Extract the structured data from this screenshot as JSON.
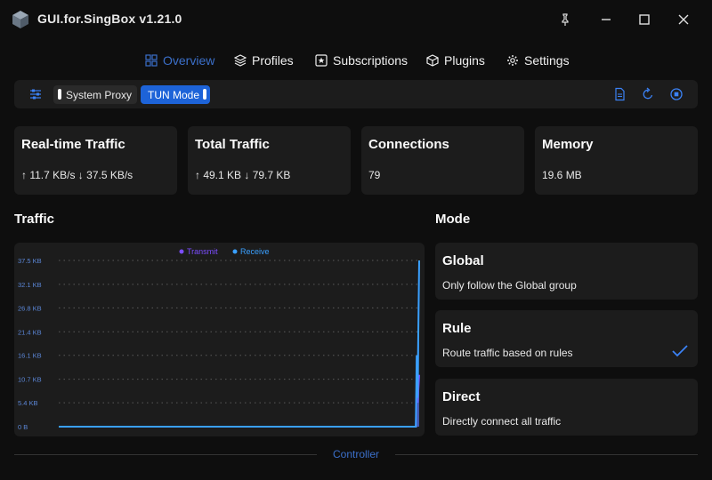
{
  "app": {
    "title": "GUI.for.SingBox v1.21.0"
  },
  "nav": {
    "overview": "Overview",
    "profiles": "Profiles",
    "subscriptions": "Subscriptions",
    "plugins": "Plugins",
    "settings": "Settings",
    "active": "overview"
  },
  "toolbar": {
    "system_proxy": "System Proxy",
    "tun_mode": "TUN Mode",
    "system_proxy_enabled": false,
    "tun_mode_enabled": true
  },
  "stats": {
    "realtime": {
      "title": "Real-time Traffic",
      "value": "↑ 11.7 KB/s ↓ 37.5 KB/s"
    },
    "total": {
      "title": "Total Traffic",
      "value": "↑ 49.1 KB ↓ 79.7 KB"
    },
    "connections": {
      "title": "Connections",
      "value": "79"
    },
    "memory": {
      "title": "Memory",
      "value": "19.6 MB"
    }
  },
  "traffic": {
    "title": "Traffic",
    "legend": {
      "transmit": "Transmit",
      "receive": "Receive"
    },
    "y_ticks": [
      "37.5 KB",
      "32.1 KB",
      "26.8 KB",
      "21.4 KB",
      "16.1 KB",
      "10.7 KB",
      "5.4 KB",
      "0 B"
    ]
  },
  "chart_data": {
    "type": "area",
    "y_ticks_kb": [
      0,
      5.4,
      10.7,
      16.1,
      21.4,
      26.8,
      32.1,
      37.5
    ],
    "ylim": [
      0,
      37.5
    ],
    "grid": true,
    "legend_position": "top-center",
    "series": [
      {
        "name": "Transmit",
        "color": "#7c4dff",
        "values": [
          0,
          0,
          0,
          0,
          0,
          0,
          0,
          0,
          0,
          0,
          0,
          0,
          0,
          0,
          0,
          0,
          0,
          0,
          0,
          0,
          0,
          0,
          0,
          0,
          0,
          0,
          0,
          0,
          0,
          0,
          0,
          0,
          0,
          0,
          0,
          0,
          0,
          0,
          0,
          0,
          0,
          0,
          0,
          0,
          0,
          0,
          0,
          0,
          0,
          0,
          0,
          0,
          0,
          0,
          0,
          0,
          0,
          0,
          0,
          0,
          0,
          0,
          0,
          0,
          0,
          0,
          0,
          0,
          0,
          0,
          0,
          0,
          0,
          0,
          0,
          0,
          0,
          0,
          0,
          0,
          0,
          0,
          0,
          0,
          0,
          0,
          0,
          0,
          0,
          0,
          0,
          0,
          0,
          0,
          0,
          0,
          0,
          0,
          0,
          0,
          0,
          0,
          0,
          0,
          0,
          0,
          0,
          0,
          0,
          0,
          0,
          0,
          0,
          0,
          0,
          0,
          0,
          0,
          0,
          0,
          0,
          0,
          0,
          0,
          0,
          0,
          0,
          0,
          0,
          0,
          0,
          0,
          0,
          0,
          0,
          0,
          0,
          0,
          0,
          0,
          0,
          0,
          0,
          0,
          0,
          0,
          0,
          0,
          0,
          0,
          0,
          0,
          0,
          0,
          0,
          0,
          0,
          0,
          0,
          0,
          0,
          0,
          0,
          0,
          0,
          0,
          0,
          0,
          0,
          0,
          0,
          0,
          0,
          0,
          0,
          0,
          0,
          0,
          0,
          0,
          0,
          0,
          0,
          0,
          0,
          0,
          0,
          0,
          0,
          0,
          0,
          0,
          0,
          0,
          0,
          0,
          0,
          0,
          0,
          0,
          0,
          0,
          0,
          0,
          0,
          0,
          0,
          0,
          0,
          0,
          0,
          0,
          0,
          0,
          0,
          0,
          0,
          0,
          0,
          0,
          0,
          0,
          0,
          0,
          0,
          0,
          0,
          0,
          0,
          0,
          0,
          0,
          0,
          0,
          0,
          0,
          0,
          0,
          0,
          0,
          0,
          0,
          0,
          0,
          0,
          0,
          0,
          0,
          0,
          0,
          0,
          0,
          0,
          0,
          0,
          0,
          0,
          0,
          0,
          0,
          0,
          0,
          0,
          0,
          0,
          0,
          0,
          0,
          0,
          0,
          0,
          0,
          0,
          0,
          0,
          0,
          0,
          0,
          0,
          0,
          0,
          0,
          0,
          0,
          0,
          0,
          0,
          0,
          0,
          0,
          0,
          0,
          0,
          0,
          0,
          0,
          0,
          0,
          0,
          0,
          0,
          0,
          0,
          0,
          0,
          0,
          0,
          0,
          0,
          0,
          0,
          0,
          0,
          0,
          0,
          0,
          0,
          0,
          0,
          0,
          0,
          0,
          0,
          0,
          0,
          0,
          0,
          0,
          0,
          0,
          0,
          0,
          0,
          0,
          0,
          0,
          0,
          0,
          0,
          0,
          0,
          0,
          0,
          0,
          0,
          0,
          0,
          0,
          0,
          0,
          0,
          0,
          0,
          0,
          0,
          0,
          0,
          0,
          0,
          0,
          0,
          0,
          0,
          0,
          0,
          0,
          0,
          0,
          0,
          0,
          0,
          0,
          0,
          0,
          0,
          0,
          0,
          0,
          0,
          0,
          0,
          0,
          0,
          0,
          0,
          0,
          0,
          0,
          0,
          0,
          0,
          0,
          0,
          0,
          0,
          0,
          0,
          0,
          0,
          0,
          0,
          0,
          0,
          0,
          0,
          0,
          0,
          0,
          0,
          0,
          0,
          0,
          0,
          0,
          0,
          0,
          0,
          0,
          0,
          0,
          0,
          0,
          0,
          0,
          0,
          0,
          0,
          0,
          0,
          0,
          0,
          0,
          0,
          0,
          0,
          10.5,
          5.4,
          8.5,
          11.7
        ]
      },
      {
        "name": "Receive",
        "color": "#3aa0ff",
        "values": [
          0,
          0,
          0,
          0,
          0,
          0,
          0,
          0,
          0,
          0,
          0,
          0,
          0,
          0,
          0,
          0,
          0,
          0,
          0,
          0,
          0,
          0,
          0,
          0,
          0,
          0,
          0,
          0,
          0,
          0,
          0,
          0,
          0,
          0,
          0,
          0,
          0,
          0,
          0,
          0,
          0,
          0,
          0,
          0,
          0,
          0,
          0,
          0,
          0,
          0,
          0,
          0,
          0,
          0,
          0,
          0,
          0,
          0,
          0,
          0,
          0,
          0,
          0,
          0,
          0,
          0,
          0,
          0,
          0,
          0,
          0,
          0,
          0,
          0,
          0,
          0,
          0,
          0,
          0,
          0,
          0,
          0,
          0,
          0,
          0,
          0,
          0,
          0,
          0,
          0,
          0,
          0,
          0,
          0,
          0,
          0,
          0,
          0,
          0,
          0,
          0,
          0,
          0,
          0,
          0,
          0,
          0,
          0,
          0,
          0,
          0,
          0,
          0,
          0,
          0,
          0,
          0,
          0,
          0,
          0,
          0,
          0,
          0,
          0,
          0,
          0,
          0,
          0,
          0,
          0,
          0,
          0,
          0,
          0,
          0,
          0,
          0,
          0,
          0,
          0,
          0,
          0,
          0,
          0,
          0,
          0,
          0,
          0,
          0,
          0,
          0,
          0,
          0,
          0,
          0,
          0,
          0,
          0,
          0,
          0,
          0,
          0,
          0,
          0,
          0,
          0,
          0,
          0,
          0,
          0,
          0,
          0,
          0,
          0,
          0,
          0,
          0,
          0,
          0,
          0,
          0,
          0,
          0,
          0,
          0,
          0,
          0,
          0,
          0,
          0,
          0,
          0,
          0,
          0,
          0,
          0,
          0,
          0,
          0,
          0,
          0,
          0,
          0,
          0,
          0,
          0,
          0,
          0,
          0,
          0,
          0,
          0,
          0,
          0,
          0,
          0,
          0,
          0,
          0,
          0,
          0,
          0,
          0,
          0,
          0,
          0,
          0,
          0,
          0,
          0,
          0,
          0,
          0,
          0,
          0,
          0,
          0,
          0,
          0,
          0,
          0,
          0,
          0,
          0,
          0,
          0,
          0,
          0,
          0,
          0,
          0,
          0,
          0,
          0,
          0,
          0,
          0,
          0,
          0,
          0,
          0,
          0,
          0,
          0,
          0,
          0,
          0,
          0,
          0,
          0,
          0,
          0,
          0,
          0,
          0,
          0,
          0,
          0,
          0,
          0,
          0,
          0,
          0,
          0,
          0,
          0,
          0,
          0,
          0,
          0,
          0,
          0,
          0,
          0,
          0,
          0,
          0,
          0,
          0,
          0,
          0,
          0,
          0,
          0,
          0,
          0,
          0,
          0,
          0,
          0,
          0,
          0,
          0,
          0,
          0,
          0,
          0,
          0,
          0,
          0,
          0,
          0,
          0,
          0,
          0,
          0,
          0,
          0,
          0,
          0,
          0,
          0,
          0,
          0,
          0,
          0,
          0,
          0,
          0,
          0,
          0,
          0,
          0,
          0,
          0,
          0,
          0,
          0,
          0,
          0,
          0,
          0,
          0,
          0,
          0,
          0,
          0,
          0,
          0,
          0,
          0,
          0,
          0,
          0,
          0,
          0,
          0,
          0,
          0,
          0,
          0,
          0,
          0,
          0,
          0,
          0,
          0,
          0,
          0,
          0,
          0,
          0,
          0,
          0,
          0,
          0,
          0,
          0,
          0,
          0,
          0,
          0,
          0,
          0,
          0,
          0,
          0,
          0,
          0,
          0,
          0,
          0,
          0,
          0,
          0,
          0,
          0,
          0,
          0,
          0,
          0,
          0,
          0,
          0,
          0,
          0,
          0,
          0,
          0,
          0,
          0,
          0,
          0,
          0,
          0,
          0,
          0,
          0,
          16.1,
          6.5,
          22.5,
          37.5
        ]
      }
    ]
  },
  "mode": {
    "title": "Mode",
    "items": [
      {
        "title": "Global",
        "desc": "Only follow the Global group",
        "selected": false
      },
      {
        "title": "Rule",
        "desc": "Route traffic based on rules",
        "selected": true
      },
      {
        "title": "Direct",
        "desc": "Directly connect all traffic",
        "selected": false
      }
    ]
  },
  "footer": {
    "controller": "Controller"
  },
  "colors": {
    "accent": "#1d63d8",
    "nav_active": "#3b6fc9",
    "check": "#3b82f6",
    "card_bg": "#1c1c1c",
    "page_bg": "#0e0e0e"
  }
}
